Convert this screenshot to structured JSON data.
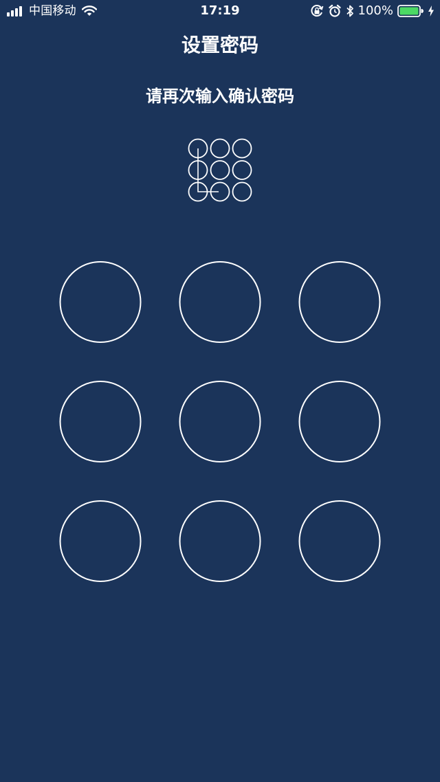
{
  "status_bar": {
    "carrier": "中国移动",
    "time": "17:19",
    "battery_percent": "100%",
    "icons": [
      "signal-bars-icon",
      "wifi-icon",
      "orientation-lock-icon",
      "alarm-icon",
      "bluetooth-icon",
      "battery-icon",
      "charging-bolt-icon"
    ]
  },
  "nav": {
    "title": "设置密码"
  },
  "prompt": "请再次输入确认密码",
  "pattern_preview": {
    "selected_nodes": [
      1,
      4,
      7,
      8
    ],
    "colors": {
      "stroke": "#ffffff"
    }
  },
  "pattern_pad": {
    "node_count": 9,
    "colors": {
      "background": "#1b345a",
      "node_stroke": "#ffffff",
      "battery_fill": "#4cd964"
    }
  }
}
